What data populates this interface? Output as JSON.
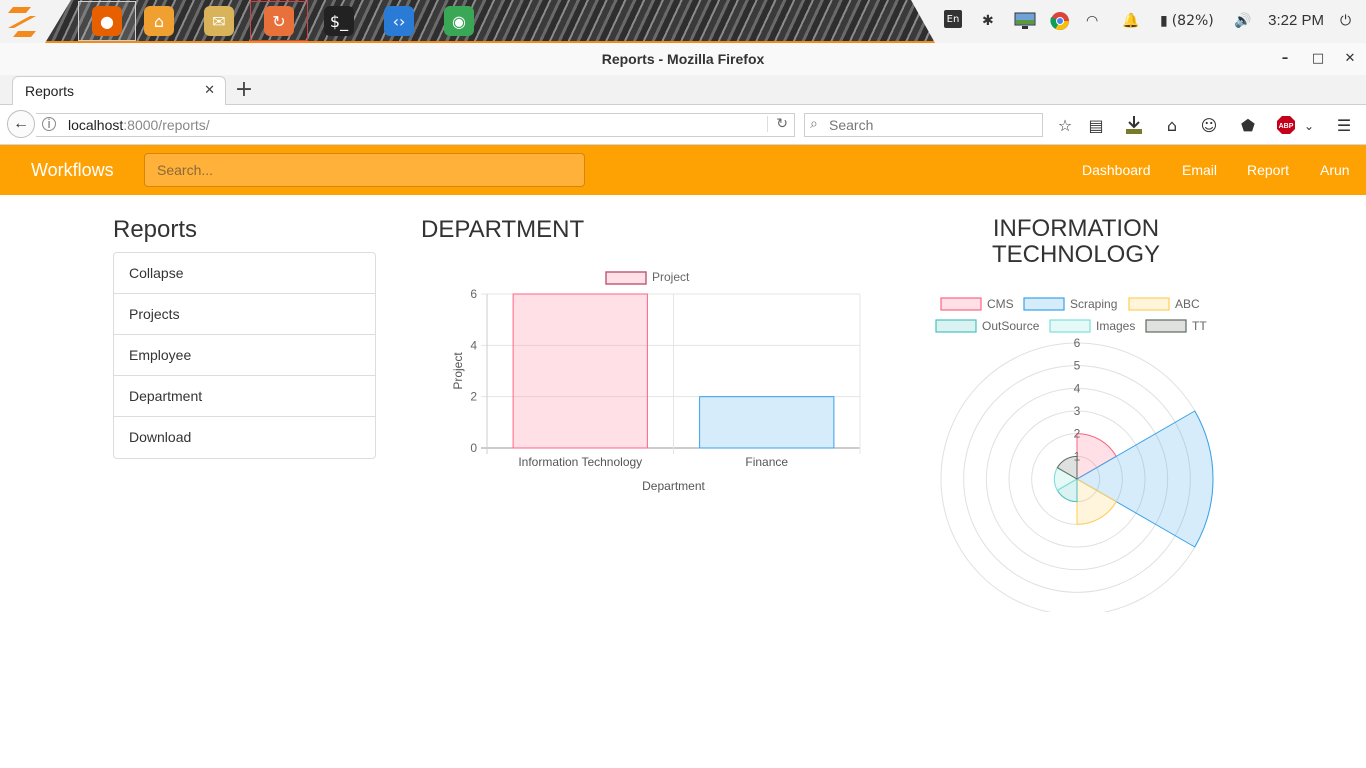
{
  "taskbar": {
    "launchers": [
      {
        "name": "firefox",
        "glyph": "●",
        "color": "#e66000"
      },
      {
        "name": "files",
        "glyph": "⌂",
        "color": "#f0a030"
      },
      {
        "name": "mail",
        "glyph": "✉",
        "color": "#d9b35a"
      },
      {
        "name": "software-updater",
        "glyph": "↻",
        "color": "#e8703a"
      },
      {
        "name": "terminal",
        "glyph": "$_",
        "color": "#222222"
      },
      {
        "name": "vscode",
        "glyph": "‹›",
        "color": "#2a7bd6"
      },
      {
        "name": "chrome",
        "glyph": "◉",
        "color": "#3aa757"
      }
    ],
    "tray": {
      "keyboard_layout": "En",
      "battery_percent": "(82%)",
      "clock": "3:22 PM"
    }
  },
  "browser": {
    "window_title": "Reports - Mozilla Firefox",
    "tab_title": "Reports",
    "url_host": "localhost",
    "url_rest": ":8000/reports/",
    "search_placeholder": "Search"
  },
  "app": {
    "brand": "Workflows",
    "search_placeholder": "Search...",
    "nav_links": [
      "Dashboard",
      "Email",
      "Report",
      "Arun"
    ]
  },
  "sidebar": {
    "title": "Reports",
    "items": [
      "Collapse",
      "Projects",
      "Employee",
      "Department",
      "Download"
    ]
  },
  "department_panel": {
    "title": "DEPARTMENT"
  },
  "it_panel": {
    "title": "INFORMATION TECHNOLOGY"
  },
  "chart_data": [
    {
      "type": "bar",
      "legend": [
        "Project"
      ],
      "categories": [
        "Information Technology",
        "Finance"
      ],
      "values": [
        6,
        2
      ],
      "colors": [
        "#ff6384",
        "#36a2eb"
      ],
      "xlabel": "Department",
      "ylabel": "Project",
      "ylim": [
        0,
        6
      ],
      "yticks": [
        0,
        2,
        4,
        6
      ],
      "grid": true,
      "legend_position": "top"
    },
    {
      "type": "polarArea",
      "labels": [
        "CMS",
        "Scraping",
        "ABC",
        "OutSource",
        "Images",
        "TT"
      ],
      "values": [
        2,
        6,
        2,
        1,
        1,
        1
      ],
      "colors": [
        "#ff6384",
        "#36a2eb",
        "#ffce56",
        "#4bc0c0",
        "#7be0d8",
        "#5a6b5e"
      ],
      "rlim": [
        0,
        6
      ],
      "rticks": [
        1,
        2,
        3,
        4,
        5,
        6
      ],
      "legend_position": "top"
    }
  ]
}
